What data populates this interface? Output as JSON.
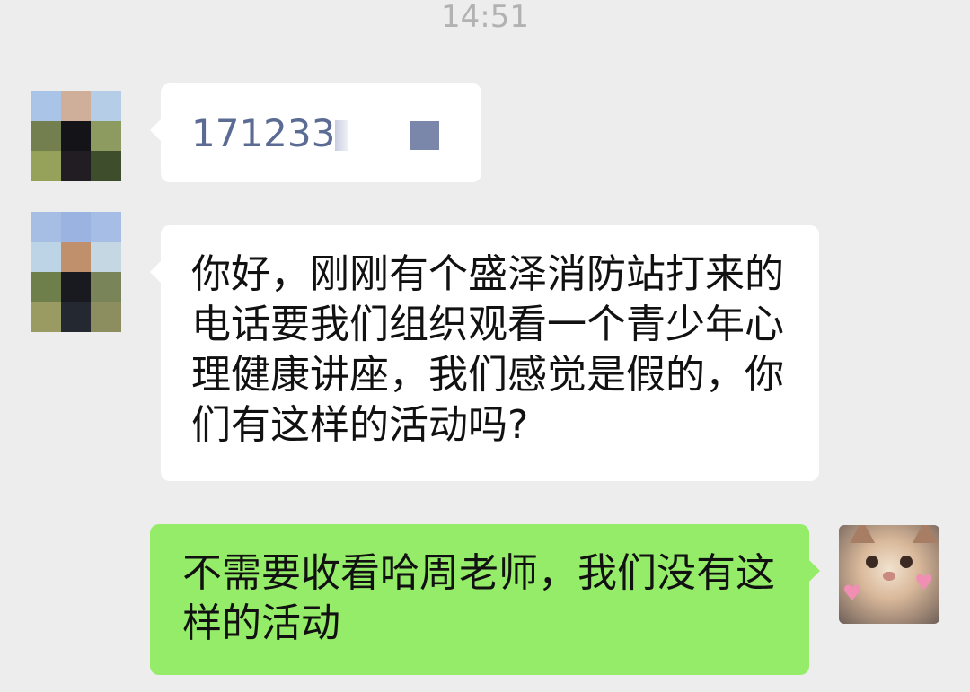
{
  "chat": {
    "timestamp": "14:51",
    "messages": [
      {
        "side": "incoming",
        "text": "171233"
      },
      {
        "side": "incoming",
        "text": "你好，刚刚有个盛泽消防站打来的电话要我们组织观看一个青少年心理健康讲座，我们感觉是假的，你们有这样的活动吗?"
      },
      {
        "side": "outgoing",
        "text": "不需要收看哈周老师，我们没有这样的活动"
      }
    ]
  },
  "avatars": {
    "contact_1_colors": [
      "#a9c4e6",
      "#cfae9a",
      "#b5cde6",
      "#747f4f",
      "#141318",
      "#8d9a60",
      "#96a25a",
      "#211d22",
      "#3e4d2c"
    ],
    "contact_2_colors": [
      "#a6bde4",
      "#9bb3e0",
      "#a6bde6",
      "#bcd4e6",
      "#c0906c",
      "#c4d7e2",
      "#6f7f4c",
      "#191a20",
      "#798559",
      "#9a9b62",
      "#242830",
      "#8c8e60"
    ],
    "self_icon": "cat-photo-icon"
  },
  "colors": {
    "background": "#ededed",
    "incoming_bubble": "#ffffff",
    "outgoing_bubble": "#95ec69",
    "link_text": "#5b6b93"
  }
}
